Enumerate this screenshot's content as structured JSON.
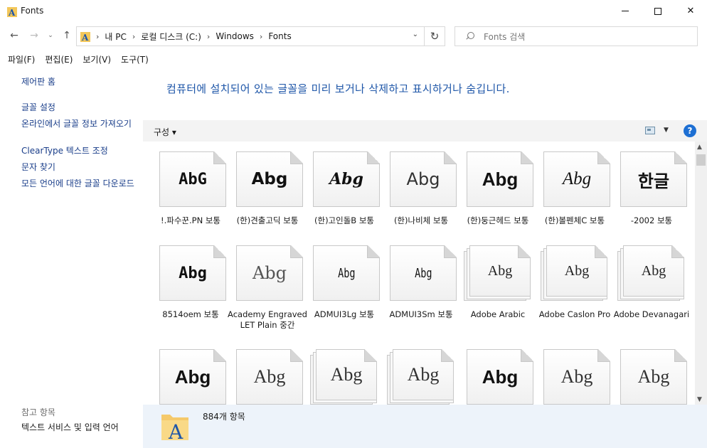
{
  "window": {
    "title": "Fonts",
    "controls": {
      "minimize": "—",
      "maximize": "☐",
      "close": "✕"
    }
  },
  "navigation": {
    "back": "←",
    "forward": "→",
    "recent": "⌄",
    "up": "↑",
    "refresh": "↻"
  },
  "address": {
    "crumbs": [
      "내 PC",
      "로컬 디스크 (C:)",
      "Windows",
      "Fonts"
    ]
  },
  "search": {
    "placeholder": "Fonts 검색"
  },
  "menu": [
    "파일(F)",
    "편집(E)",
    "보기(V)",
    "도구(T)"
  ],
  "sidebar": {
    "links": [
      "제어판 홈",
      "글꼴 설정",
      "온라인에서 글꼴 정보 가져오기",
      "ClearType 텍스트 조정",
      "문자 찾기",
      "모든 언어에 대한 글꼴 다운로드"
    ],
    "see_also_title": "참고 항목",
    "see_also": [
      "텍스트 서비스 및 입력 언어"
    ]
  },
  "main": {
    "heading": "컴퓨터에 설치되어 있는 글꼴을 미리 보거나 삭제하고 표시하거나 숨깁니다."
  },
  "toolbar": {
    "organize": "구성",
    "help": "?"
  },
  "fonts": [
    {
      "sample": "AbG",
      "label": "!.파수꾼.PN 보통",
      "style": "mono",
      "stack": false
    },
    {
      "sample": "Abg",
      "label": "(한)견출고딕 보통",
      "style": "bold",
      "stack": false
    },
    {
      "sample": "Abg",
      "label": "(한)고인돌B 보통",
      "style": "italic",
      "stack": false
    },
    {
      "sample": "Abg",
      "label": "(한)나비체 보통",
      "style": "sans",
      "stack": false
    },
    {
      "sample": "Abg",
      "label": "(한)둥근헤드 보통",
      "style": "bold-lg",
      "stack": false
    },
    {
      "sample": "Abg",
      "label": "(한)볼펜체C 보통",
      "style": "script",
      "stack": false
    },
    {
      "sample": "한글",
      "label": "-2002 보통",
      "style": "hangul",
      "stack": false
    },
    {
      "sample": "Abg",
      "label": "8514oem 보통",
      "style": "mono",
      "stack": false
    },
    {
      "sample": "Abg",
      "label": "Academy Engraved LET Plain 중간",
      "style": "serif",
      "stack": false
    },
    {
      "sample": "Abg",
      "label": "ADMUI3Lg 보통",
      "style": "cond",
      "stack": false
    },
    {
      "sample": "Abg",
      "label": "ADMUI3Sm 보통",
      "style": "cond",
      "stack": false
    },
    {
      "sample": "Abg",
      "label": "Adobe Arabic",
      "style": "serif-sm",
      "stack": true
    },
    {
      "sample": "Abg",
      "label": "Adobe Caslon Pro",
      "style": "serif-sm",
      "stack": true
    },
    {
      "sample": "Abg",
      "label": "Adobe Devanagari",
      "style": "serif-sm",
      "stack": true
    },
    {
      "sample": "Abg",
      "label": "",
      "style": "bold-lg",
      "stack": false
    },
    {
      "sample": "Abg",
      "label": "",
      "style": "serif-lg",
      "stack": false
    },
    {
      "sample": "Abg",
      "label": "",
      "style": "serif-lg",
      "stack": true
    },
    {
      "sample": "Abg",
      "label": "",
      "style": "serif-lg",
      "stack": true
    },
    {
      "sample": "Abg",
      "label": "",
      "style": "bold-lg",
      "stack": false
    },
    {
      "sample": "Abg",
      "label": "",
      "style": "serif-lg",
      "stack": false
    },
    {
      "sample": "Abg",
      "label": "",
      "style": "serif-lg",
      "stack": false
    }
  ],
  "details": {
    "count": "884개 항목"
  },
  "colors": {
    "link": "#1a3e8a",
    "heading": "#1e56a8",
    "details_bg": "#edf3fa",
    "help": "#1d6fd3"
  }
}
